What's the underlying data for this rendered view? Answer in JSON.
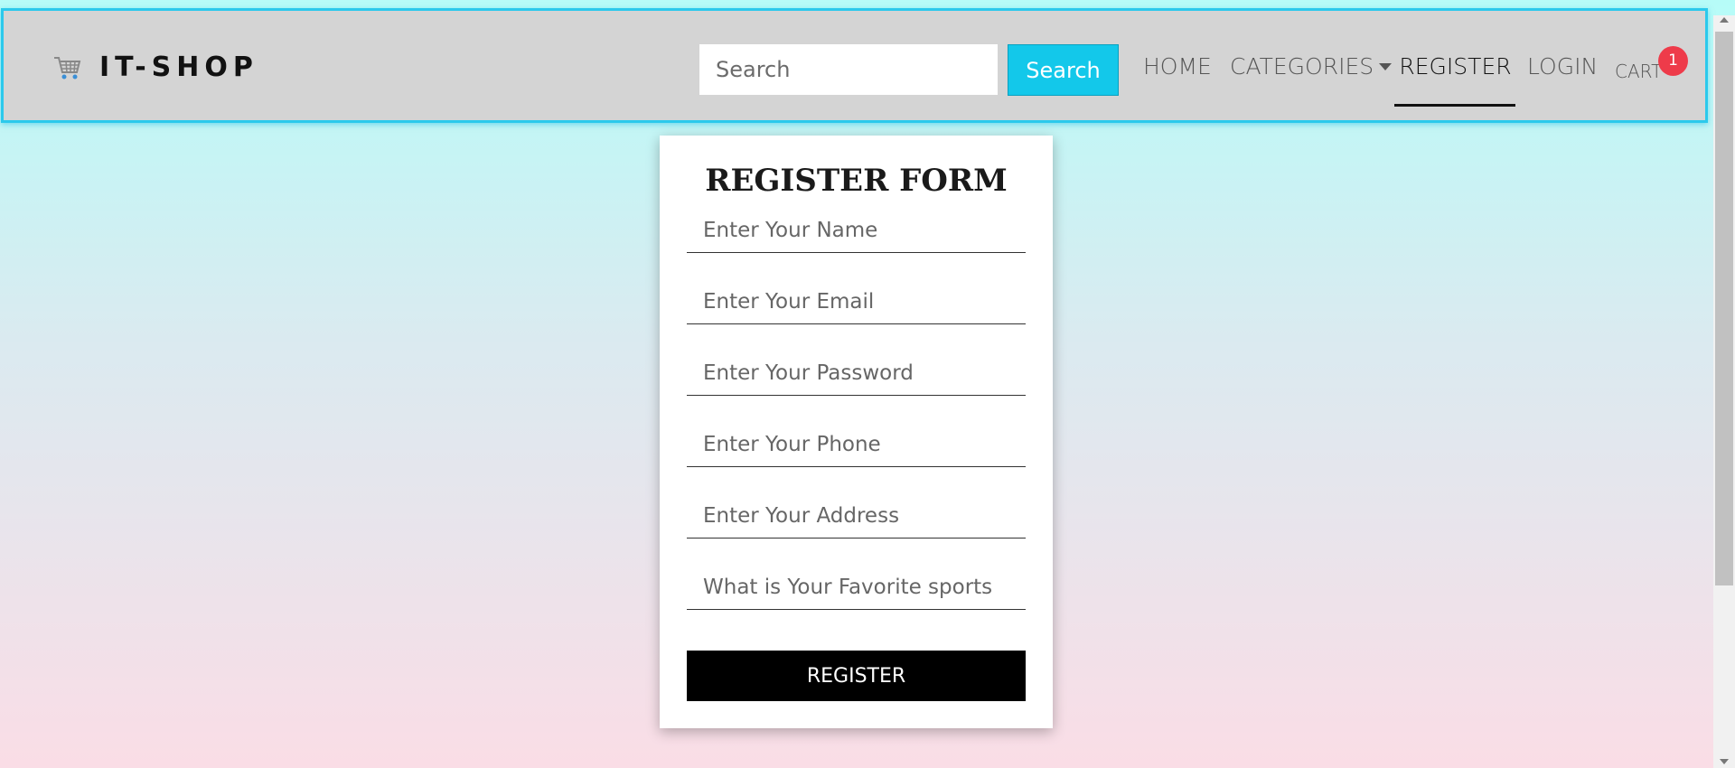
{
  "navbar": {
    "brand_name": "IT-SHOP",
    "brand_icon": "shopping-cart-icon",
    "search_placeholder": "Search",
    "search_button": "Search",
    "links": {
      "home": "HOME",
      "categories": "CATEGORIES",
      "register": "REGISTER",
      "login": "LOGIN",
      "cart": "CART"
    },
    "active_link": "register",
    "cart_count": "1"
  },
  "form": {
    "title": "REGISTER FORM",
    "fields": {
      "name": "Enter Your Name",
      "email": "Enter Your Email",
      "password": "Enter Your Password",
      "phone": "Enter Your Phone",
      "address": "Enter Your Address",
      "answer": "What is Your Favorite sports"
    },
    "submit_label": "REGISTER"
  },
  "colors": {
    "navbar_bg": "#d4d4d4",
    "navbar_border": "#2bc9ec",
    "search_button_bg": "#13c8ea",
    "badge_bg": "#ee3b4a",
    "gradient_top": "#b6fcf8",
    "gradient_bottom": "#fadde6"
  }
}
